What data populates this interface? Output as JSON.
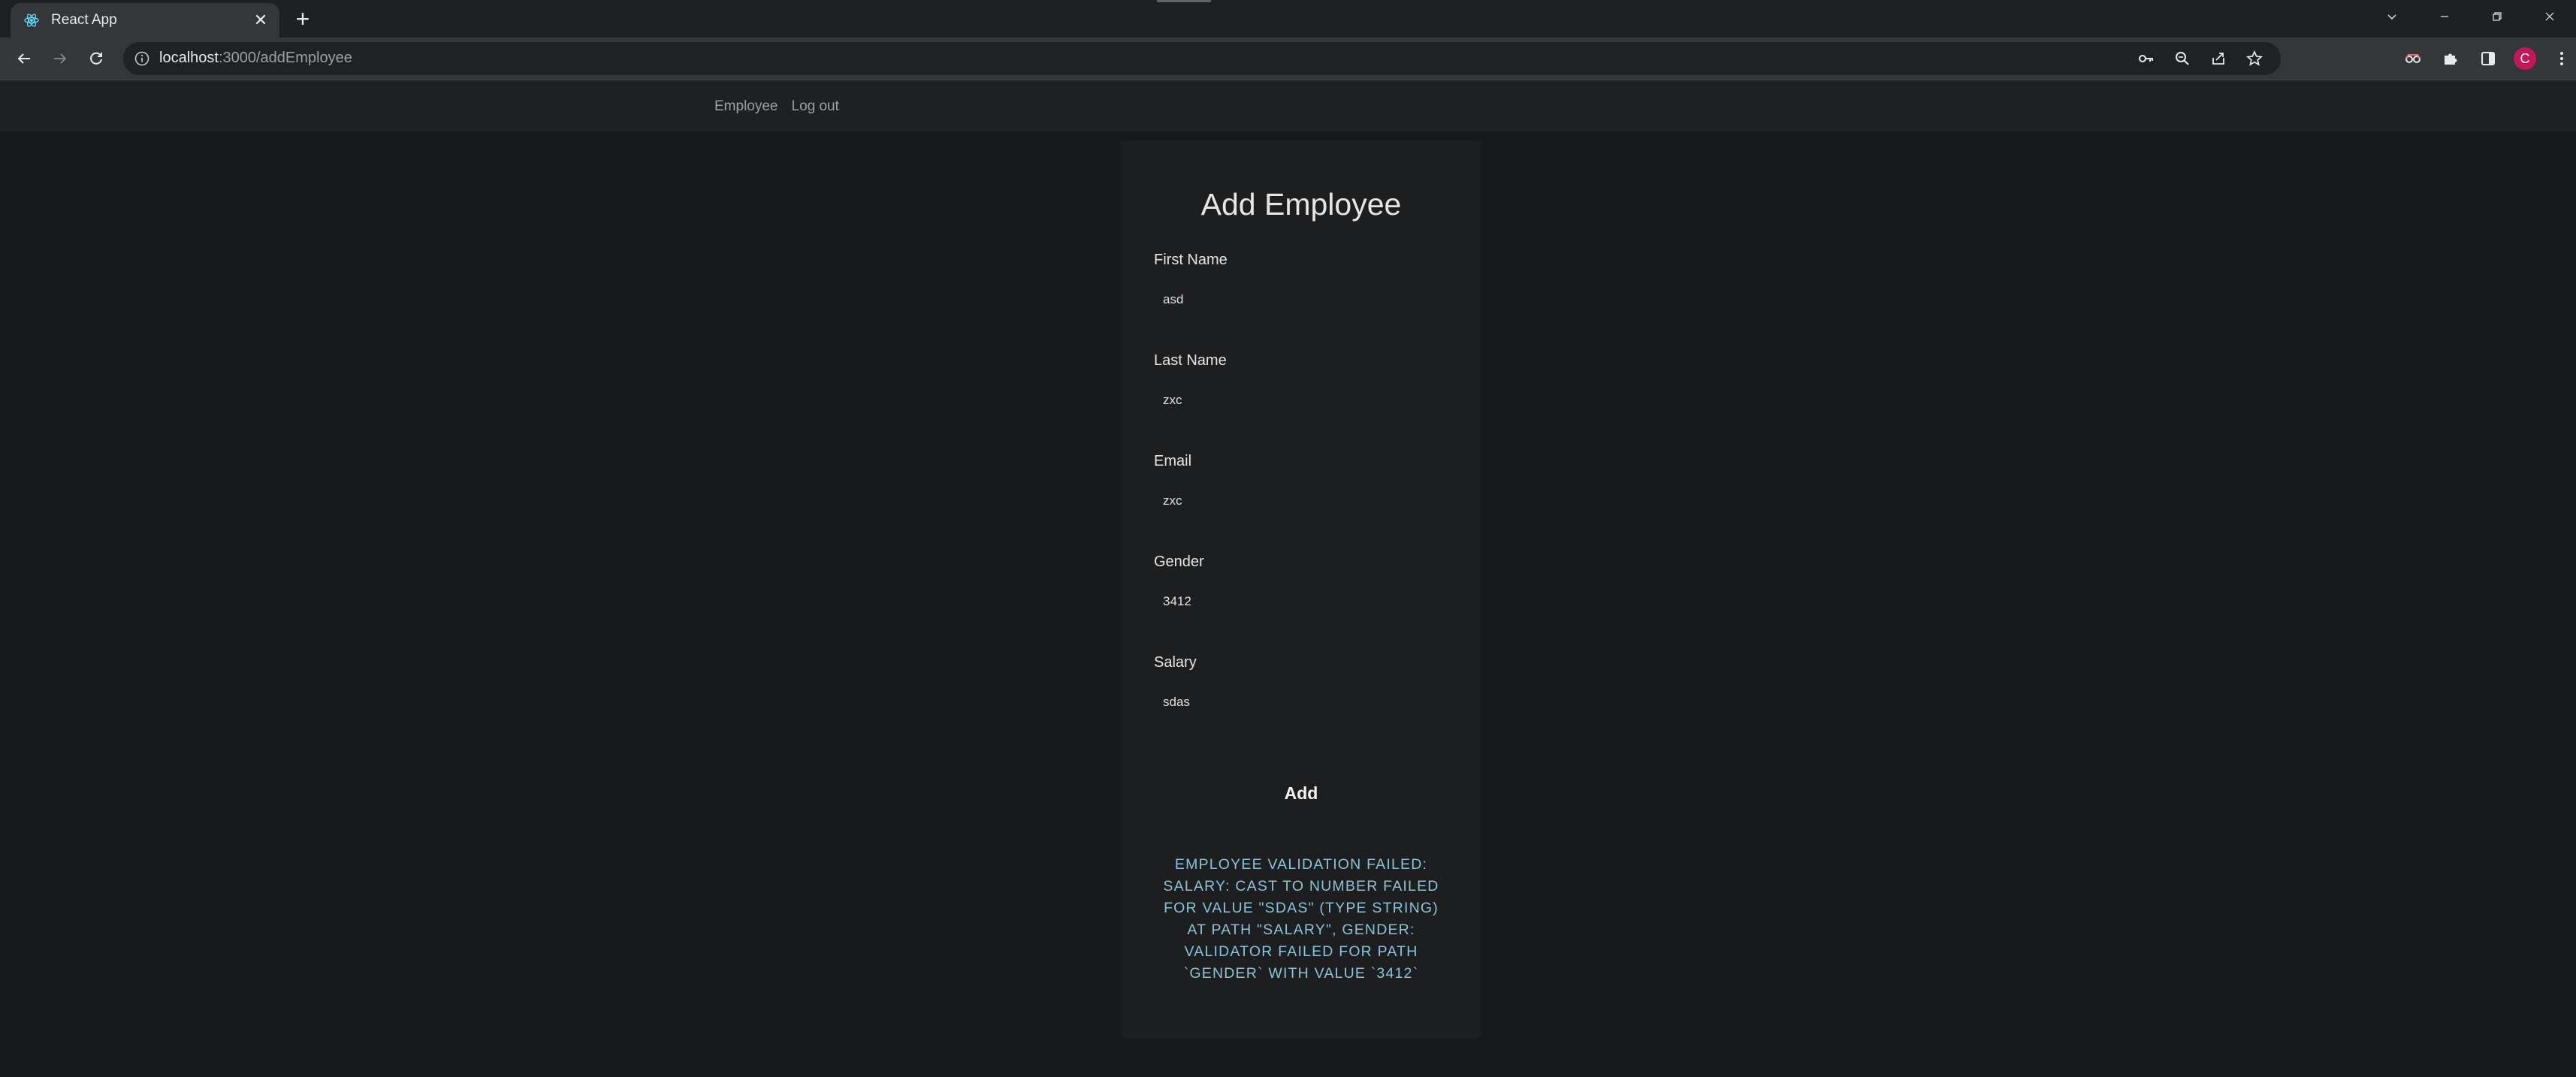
{
  "browser": {
    "tab_title": "React App",
    "url_host": "localhost",
    "url_path": ":3000/addEmployee",
    "avatar_letter": "C",
    "accent_color": "#c2185b"
  },
  "navbar": {
    "links": [
      "Employee",
      "Log out"
    ]
  },
  "form": {
    "title": "Add Employee",
    "fields": [
      {
        "label": "First Name",
        "value": "asd"
      },
      {
        "label": "Last Name",
        "value": "zxc"
      },
      {
        "label": "Email",
        "value": "zxc"
      },
      {
        "label": "Gender",
        "value": "3412"
      },
      {
        "label": "Salary",
        "value": "sdas"
      }
    ],
    "submit_label": "Add",
    "error_message": "EMPLOYEE VALIDATION FAILED: SALARY: CAST TO NUMBER FAILED FOR VALUE \"SDAS\" (TYPE STRING) AT PATH \"SALARY\", GENDER: VALIDATOR FAILED FOR PATH `GENDER` WITH VALUE `3412`",
    "error_color": "#8bc3d8"
  }
}
